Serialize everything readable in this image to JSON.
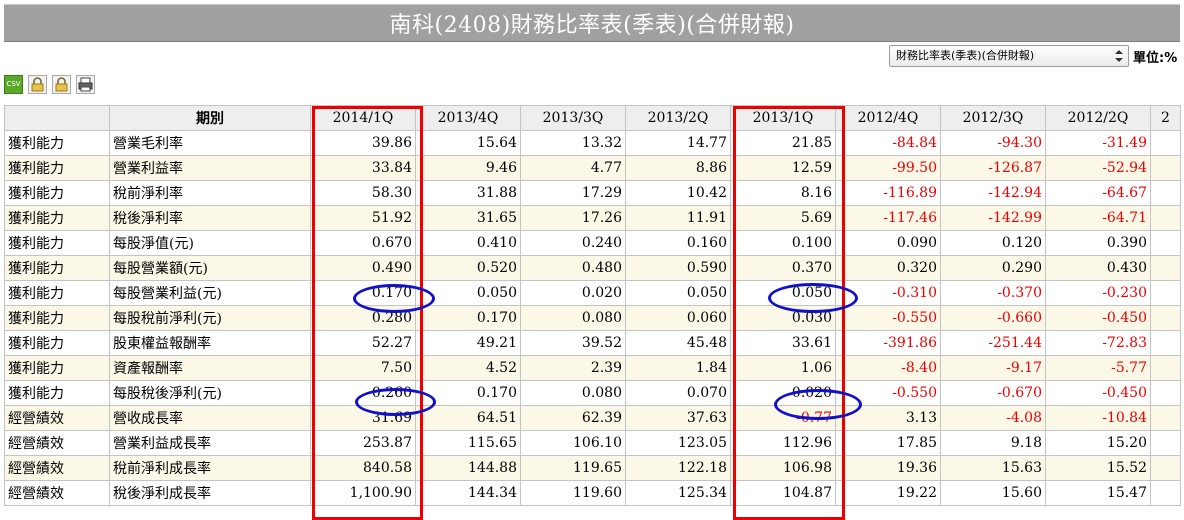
{
  "title": "南科(2408)財務比率表(季表)(合併財報)",
  "report_select": {
    "value": "財務比率表(季表)(合併財報)"
  },
  "unit_label": "單位:%",
  "toolbar": {
    "csv_label": "CSV"
  },
  "table": {
    "header_period": "期別",
    "periods": [
      "2014/1Q",
      "2013/4Q",
      "2013/3Q",
      "2013/2Q",
      "2013/1Q",
      "2012/4Q",
      "2012/3Q",
      "2012/2Q",
      "2"
    ],
    "rows": [
      {
        "category": "獲利能力",
        "item": "營業毛利率",
        "values": [
          "39.86",
          "15.64",
          "13.32",
          "14.77",
          "21.85",
          "-84.84",
          "-94.30",
          "-31.49"
        ]
      },
      {
        "category": "獲利能力",
        "item": "營業利益率",
        "values": [
          "33.84",
          "9.46",
          "4.77",
          "8.86",
          "12.59",
          "-99.50",
          "-126.87",
          "-52.94"
        ]
      },
      {
        "category": "獲利能力",
        "item": "稅前淨利率",
        "values": [
          "58.30",
          "31.88",
          "17.29",
          "10.42",
          "8.16",
          "-116.89",
          "-142.94",
          "-64.67"
        ]
      },
      {
        "category": "獲利能力",
        "item": "稅後淨利率",
        "values": [
          "51.92",
          "31.65",
          "17.26",
          "11.91",
          "5.69",
          "-117.46",
          "-142.99",
          "-64.71"
        ]
      },
      {
        "category": "獲利能力",
        "item": "每股淨值(元)",
        "values": [
          "0.670",
          "0.410",
          "0.240",
          "0.160",
          "0.100",
          "0.090",
          "0.120",
          "0.390"
        ]
      },
      {
        "category": "獲利能力",
        "item": "每股營業額(元)",
        "values": [
          "0.490",
          "0.520",
          "0.480",
          "0.590",
          "0.370",
          "0.320",
          "0.290",
          "0.430"
        ]
      },
      {
        "category": "獲利能力",
        "item": "每股營業利益(元)",
        "values": [
          "0.170",
          "0.050",
          "0.020",
          "0.050",
          "0.050",
          "-0.310",
          "-0.370",
          "-0.230"
        ]
      },
      {
        "category": "獲利能力",
        "item": "每股稅前淨利(元)",
        "values": [
          "0.280",
          "0.170",
          "0.080",
          "0.060",
          "0.030",
          "-0.550",
          "-0.660",
          "-0.450"
        ]
      },
      {
        "category": "獲利能力",
        "item": "股東權益報酬率",
        "values": [
          "52.27",
          "49.21",
          "39.52",
          "45.48",
          "33.61",
          "-391.86",
          "-251.44",
          "-72.83"
        ]
      },
      {
        "category": "獲利能力",
        "item": "資產報酬率",
        "values": [
          "7.50",
          "4.52",
          "2.39",
          "1.84",
          "1.06",
          "-8.40",
          "-9.17",
          "-5.77"
        ]
      },
      {
        "category": "獲利能力",
        "item": "每股稅後淨利(元)",
        "values": [
          "0.260",
          "0.170",
          "0.080",
          "0.070",
          "0.020",
          "-0.550",
          "-0.670",
          "-0.450"
        ]
      },
      {
        "category": "經營績效",
        "item": "營收成長率",
        "values": [
          "31.69",
          "64.51",
          "62.39",
          "37.63",
          "-0.77",
          "3.13",
          "-4.08",
          "-10.84"
        ]
      },
      {
        "category": "經營績效",
        "item": "營業利益成長率",
        "values": [
          "253.87",
          "115.65",
          "106.10",
          "123.05",
          "112.96",
          "17.85",
          "9.18",
          "15.20"
        ]
      },
      {
        "category": "經營績效",
        "item": "稅前淨利成長率",
        "values": [
          "840.58",
          "144.88",
          "119.65",
          "122.18",
          "106.98",
          "19.36",
          "15.63",
          "15.52"
        ]
      },
      {
        "category": "經營績效",
        "item": "稅後淨利成長率",
        "values": [
          "1,100.90",
          "144.34",
          "119.60",
          "125.34",
          "104.87",
          "19.22",
          "15.60",
          "15.47"
        ]
      }
    ]
  },
  "colors": {
    "title_bg": "#a0a0a0",
    "negative_text": "#ee0000",
    "highlight_box": "#ee0000",
    "highlight_ellipse": "#1010cc",
    "row_alt_bg": "#fbf8e7"
  }
}
